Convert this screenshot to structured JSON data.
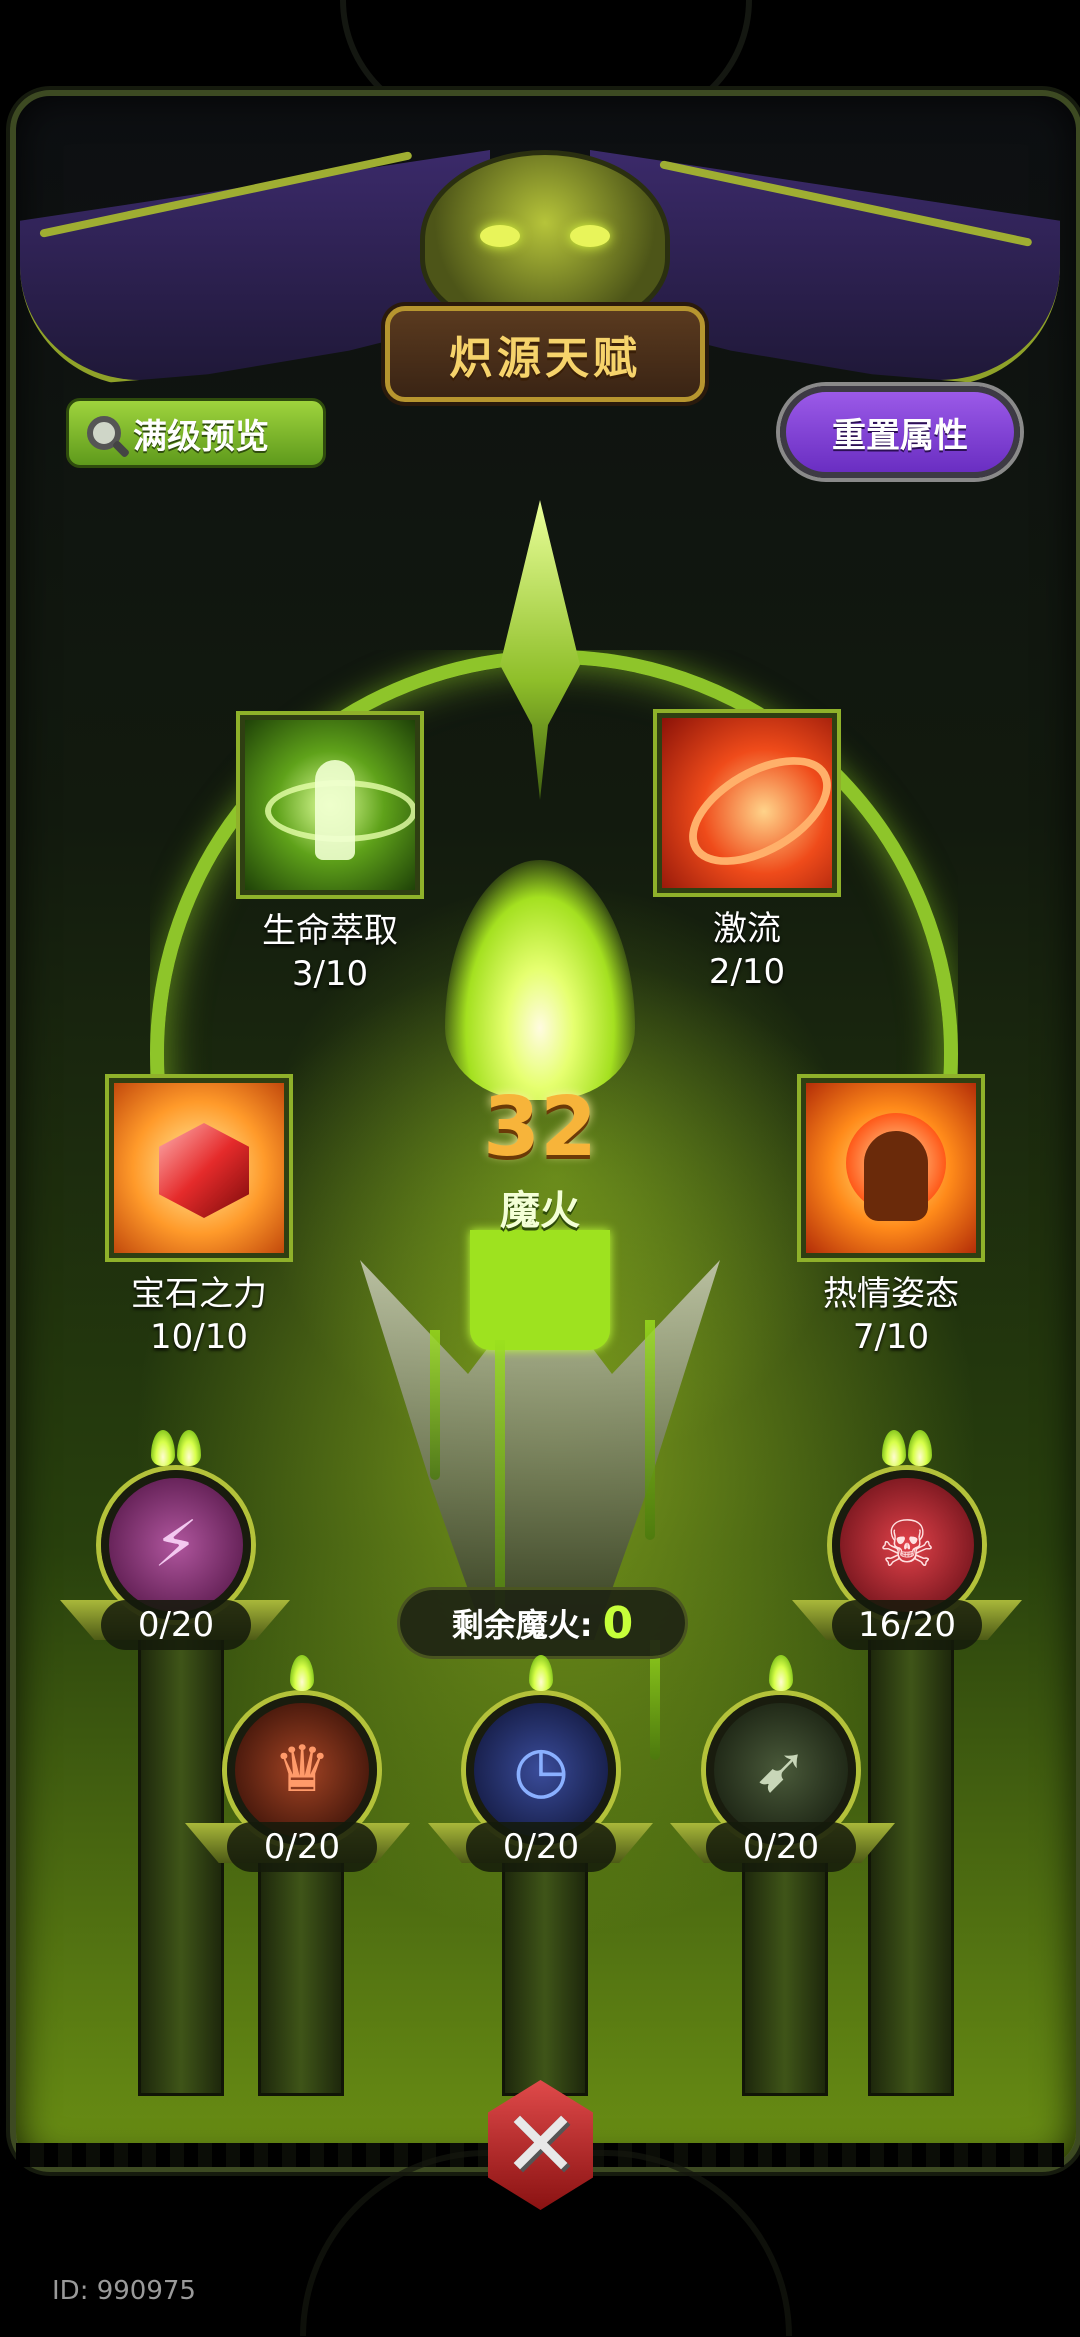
{
  "header": {
    "title": "炽源天赋",
    "preview_button": "满级预览",
    "reset_button": "重置属性"
  },
  "center": {
    "magic_fire_count": "32",
    "magic_fire_label": "魔火"
  },
  "skills": [
    {
      "name": "生命萃取",
      "progress": "3/10",
      "icon": "life-extraction-icon"
    },
    {
      "name": "激流",
      "progress": "2/10",
      "icon": "torrent-icon"
    },
    {
      "name": "宝石之力",
      "progress": "10/10",
      "icon": "gem-power-icon"
    },
    {
      "name": "热情姿态",
      "progress": "7/10",
      "icon": "passion-stance-icon"
    }
  ],
  "nodes": [
    {
      "progress": "0/20",
      "icon": "lightning-burst-icon",
      "color": "#7a2a6a"
    },
    {
      "progress": "16/20",
      "icon": "skull-bomb-icon",
      "color": "#8a1a24"
    },
    {
      "progress": "0/20",
      "icon": "fire-crown-icon",
      "color": "#5a1e10"
    },
    {
      "progress": "0/20",
      "icon": "stopwatch-icon",
      "color": "#1a1f4a"
    },
    {
      "progress": "0/20",
      "icon": "wind-slash-icon",
      "color": "#1e2a12"
    }
  ],
  "remaining": {
    "label": "剩余魔火:",
    "value": "0"
  },
  "footer": {
    "id_text": "ID: 990975",
    "close_icon": "close-icon"
  },
  "colors": {
    "accent_green": "#9ee21f",
    "title_gold": "#f6d36b",
    "count_orange": "#f7b43a",
    "reset_purple": "#7c3fd6"
  }
}
